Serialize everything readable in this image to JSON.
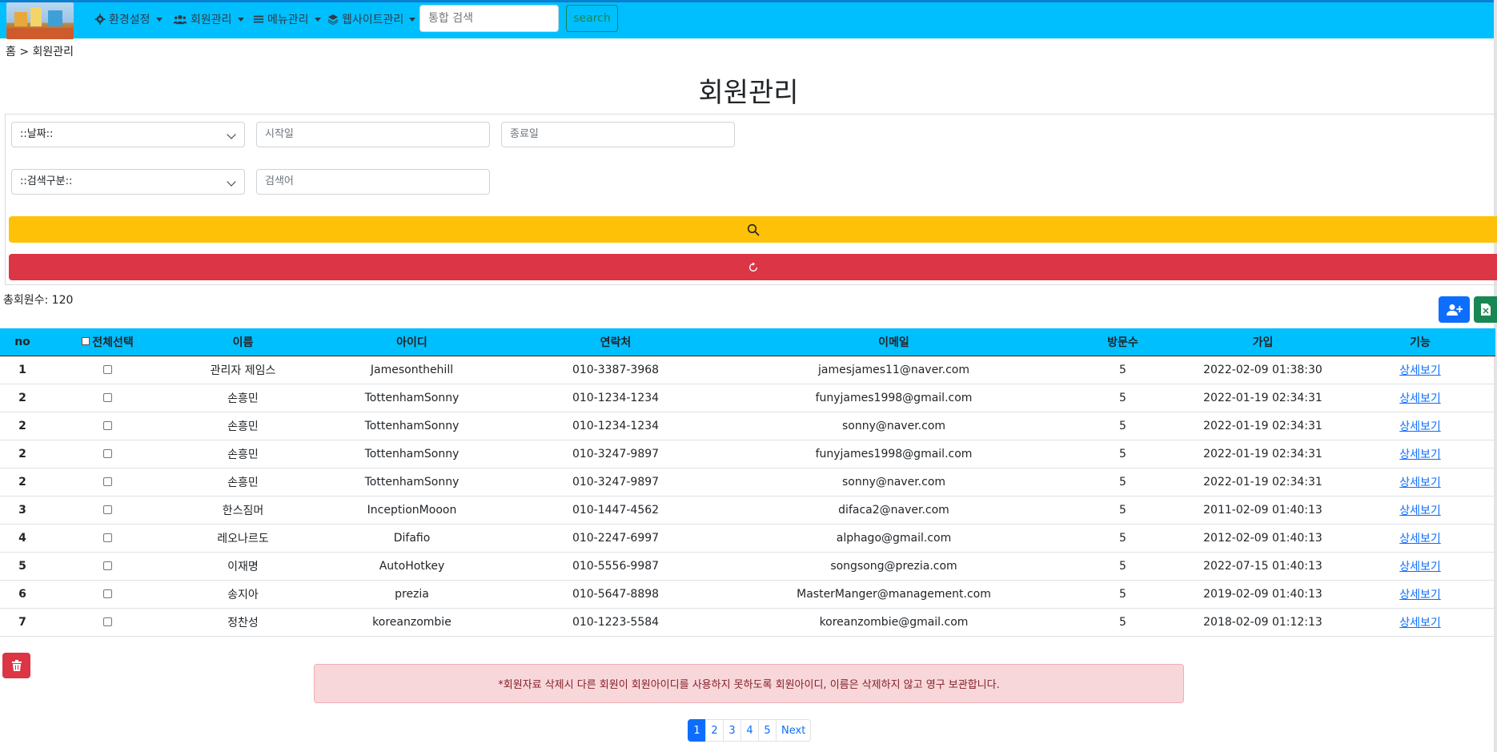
{
  "nav": {
    "menus": [
      {
        "label": "환경설정",
        "icon": "gear-icon"
      },
      {
        "label": "회원관리",
        "icon": "users-icon"
      },
      {
        "label": "메뉴관리",
        "icon": "list-icon"
      },
      {
        "label": "웹사이트관리",
        "icon": "layers-icon"
      }
    ],
    "search_placeholder": "통합 검색",
    "search_button": "search"
  },
  "breadcrumb": "홈 > 회원관리",
  "page_title": "회원관리",
  "filters": {
    "date_select": "::날짜::",
    "start_placeholder": "시작일",
    "end_placeholder": "종료일",
    "category_select": "::검색구분::",
    "keyword_placeholder": "검색어"
  },
  "total_label": "총회원수: 120",
  "table": {
    "headers": [
      "no",
      "전체선택",
      "이름",
      "아이디",
      "연락처",
      "이메일",
      "방문수",
      "가입",
      "기능"
    ],
    "detail_label": "상세보기",
    "rows": [
      {
        "no": "1",
        "name": "관리자 제임스",
        "id": "Jamesonthehill",
        "phone": "010-3387-3968",
        "email": "jamesjames11@naver.com",
        "visits": "5",
        "joined": "2022-02-09 01:38:30"
      },
      {
        "no": "2",
        "name": "손흥민",
        "id": "TottenhamSonny",
        "phone": "010-1234-1234",
        "email": "funyjames1998@gmail.com",
        "visits": "5",
        "joined": "2022-01-19 02:34:31"
      },
      {
        "no": "2",
        "name": "손흥민",
        "id": "TottenhamSonny",
        "phone": "010-1234-1234",
        "email": "sonny@naver.com",
        "visits": "5",
        "joined": "2022-01-19 02:34:31"
      },
      {
        "no": "2",
        "name": "손흥민",
        "id": "TottenhamSonny",
        "phone": "010-3247-9897",
        "email": "funyjames1998@gmail.com",
        "visits": "5",
        "joined": "2022-01-19 02:34:31"
      },
      {
        "no": "2",
        "name": "손흥민",
        "id": "TottenhamSonny",
        "phone": "010-3247-9897",
        "email": "sonny@naver.com",
        "visits": "5",
        "joined": "2022-01-19 02:34:31"
      },
      {
        "no": "3",
        "name": "한스짐머",
        "id": "InceptionMooon",
        "phone": "010-1447-4562",
        "email": "difaca2@naver.com",
        "visits": "5",
        "joined": "2011-02-09 01:40:13"
      },
      {
        "no": "4",
        "name": "레오나르도",
        "id": "Difafio",
        "phone": "010-2247-6997",
        "email": "alphago@gmail.com",
        "visits": "5",
        "joined": "2012-02-09 01:40:13"
      },
      {
        "no": "5",
        "name": "이재명",
        "id": "AutoHotkey",
        "phone": "010-5556-9987",
        "email": "songsong@prezia.com",
        "visits": "5",
        "joined": "2022-07-15 01:40:13"
      },
      {
        "no": "6",
        "name": "송지아",
        "id": "prezia",
        "phone": "010-5647-8898",
        "email": "MasterManger@management.com",
        "visits": "5",
        "joined": "2019-02-09 01:40:13"
      },
      {
        "no": "7",
        "name": "정찬성",
        "id": "koreanzombie",
        "phone": "010-1223-5584",
        "email": "koreanzombie@gmail.com",
        "visits": "5",
        "joined": "2018-02-09 01:12:13"
      }
    ]
  },
  "alert": "*회원자료 삭제시 다른 회원이 회원아이디를 사용하지 못하도록 회원아이디, 이름은 삭제하지 않고 영구 보관합니다.",
  "pagination": [
    "1",
    "2",
    "3",
    "4",
    "5",
    "Next"
  ]
}
